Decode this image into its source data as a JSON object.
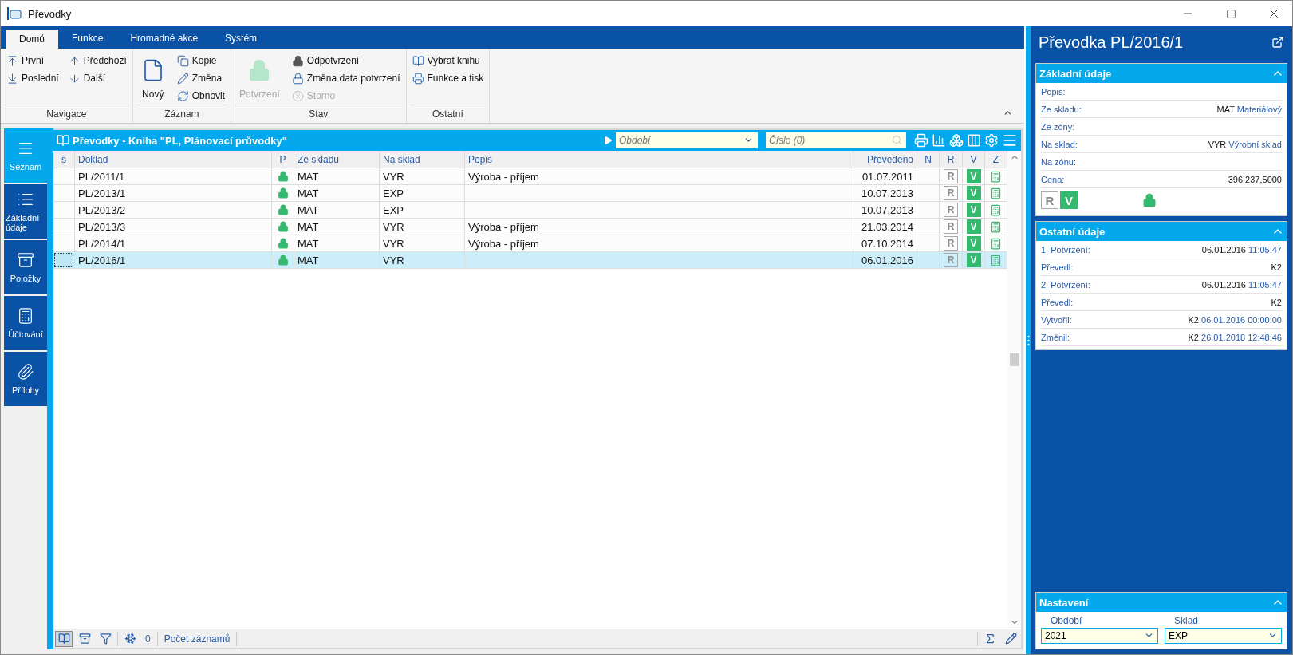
{
  "window": {
    "title": "Převodky"
  },
  "ribbon": {
    "tabs": [
      {
        "label": "Domů",
        "selected": true
      },
      {
        "label": "Funkce",
        "selected": false
      },
      {
        "label": "Hromadné akce",
        "selected": false
      },
      {
        "label": "Systém",
        "selected": false
      }
    ],
    "groups": [
      {
        "label": "Navigace",
        "items": [
          {
            "label": "První",
            "kind": "small",
            "disabled": false
          },
          {
            "label": "Poslední",
            "kind": "small",
            "disabled": false
          },
          {
            "label": "Předchozí",
            "kind": "small",
            "disabled": false
          },
          {
            "label": "Další",
            "kind": "small",
            "disabled": false
          }
        ]
      },
      {
        "label": "Záznam",
        "items": [
          {
            "label": "Nový",
            "kind": "large",
            "disabled": false
          },
          {
            "label": "Kopie",
            "kind": "small",
            "disabled": false
          },
          {
            "label": "Změna",
            "kind": "small",
            "disabled": false
          },
          {
            "label": "Obnovit",
            "kind": "small",
            "disabled": false
          }
        ]
      },
      {
        "label": "Stav",
        "items": [
          {
            "label": "Potvrzení",
            "kind": "large",
            "disabled": true
          },
          {
            "label": "Odpotvrzení",
            "kind": "small",
            "disabled": false
          },
          {
            "label": "Změna data potvrzení",
            "kind": "small",
            "disabled": false
          },
          {
            "label": "Storno",
            "kind": "small",
            "disabled": true
          }
        ]
      },
      {
        "label": "Ostatní",
        "items": [
          {
            "label": "Vybrat knihu",
            "kind": "small",
            "disabled": false
          },
          {
            "label": "Funkce a tisk",
            "kind": "small",
            "disabled": false
          }
        ]
      }
    ]
  },
  "sidebar": {
    "items": [
      {
        "label": "Seznam",
        "selected": true
      },
      {
        "label": "Základní údaje",
        "selected": false
      },
      {
        "label": "Položky",
        "selected": false
      },
      {
        "label": "Účtování",
        "selected": false
      },
      {
        "label": "Přílohy",
        "selected": false
      }
    ]
  },
  "grid": {
    "title": "Převodky - Kniha \"PL, Plánovací průvodky\"",
    "filters": [
      {
        "placeholder": "Období"
      },
      {
        "placeholder": "Číslo (0)"
      }
    ],
    "columns": [
      "s",
      "Doklad",
      "P",
      "Ze skladu",
      "Na sklad",
      "Popis",
      "Převedeno",
      "N",
      "R",
      "V",
      "Z"
    ],
    "rows": [
      {
        "doklad": "PL/2011/1",
        "locked": true,
        "ze_skladu": "MAT",
        "na_sklad": "VYR",
        "popis": "Výroba - příjem",
        "prevedeno": "01.07.2011",
        "r": "R",
        "r_active": false,
        "v": "V",
        "v_active": true,
        "selected": false
      },
      {
        "doklad": "PL/2013/1",
        "locked": true,
        "ze_skladu": "MAT",
        "na_sklad": "EXP",
        "prevedeno": "10.07.2013",
        "r": "R",
        "r_active": false,
        "v": "V",
        "v_active": true,
        "selected": false
      },
      {
        "doklad": "PL/2013/2",
        "locked": true,
        "ze_skladu": "MAT",
        "na_sklad": "EXP",
        "prevedeno": "10.07.2013",
        "r": "R",
        "r_active": false,
        "v": "V",
        "v_active": true,
        "selected": false
      },
      {
        "doklad": "PL/2013/3",
        "locked": true,
        "ze_skladu": "MAT",
        "na_sklad": "VYR",
        "popis": "Výroba - příjem",
        "prevedeno": "21.03.2014",
        "r": "R",
        "r_active": false,
        "v": "V",
        "v_active": true,
        "selected": false
      },
      {
        "doklad": "PL/2014/1",
        "locked": true,
        "ze_skladu": "MAT",
        "na_sklad": "VYR",
        "popis": "Výroba - příjem",
        "prevedeno": "07.10.2014",
        "r": "R",
        "r_active": false,
        "v": "V",
        "v_active": true,
        "selected": false
      },
      {
        "doklad": "PL/2016/1",
        "locked": true,
        "ze_skladu": "MAT",
        "na_sklad": "VYR",
        "prevedeno": "06.01.2016",
        "r": "R",
        "r_active": false,
        "v": "V",
        "v_active": true,
        "selected": true
      }
    ],
    "status_bar": {
      "count": "0",
      "label": "Počet záznamů"
    }
  },
  "detail": {
    "title": "Převodka PL/2016/1",
    "sections": [
      {
        "title": "Základní údaje",
        "expanded": true,
        "fields": [
          {
            "label": "Popis:"
          },
          {
            "label": "Ze skladu:",
            "value": "MAT",
            "detail": "Materiálový"
          },
          {
            "label": "Ze zóny:"
          },
          {
            "label": "Na sklad:",
            "value": "VYR",
            "detail": "Výrobní sklad"
          },
          {
            "label": "Na zónu:"
          },
          {
            "label": "Cena:",
            "value": "396 237,5000"
          }
        ],
        "badges": [
          {
            "label": "R",
            "active": false
          },
          {
            "label": "V",
            "active": true
          }
        ],
        "locked": true
      },
      {
        "title": "Ostatní údaje",
        "expanded": true,
        "fields": [
          {
            "label": "1. Potvrzení:",
            "value": "06.01.2016",
            "detail": "11:05:47"
          },
          {
            "label": "Převedl:",
            "value": "K2"
          },
          {
            "label": "2. Potvrzení:",
            "value": "06.01.2016",
            "detail": "11:05:47"
          },
          {
            "label": "Převedl:",
            "value": "K2"
          },
          {
            "label": "Vytvořil:",
            "value": "K2",
            "detail": "06.01.2016 00:00:00"
          },
          {
            "label": "Změnil:",
            "value": "K2",
            "detail": "26.01.2018 12:48:46"
          }
        ]
      }
    ],
    "settings": {
      "title": "Nastavení",
      "expanded": true,
      "fields": [
        {
          "label": "Období",
          "value": "2021"
        },
        {
          "label": "Sklad",
          "value": "EXP"
        }
      ]
    }
  }
}
